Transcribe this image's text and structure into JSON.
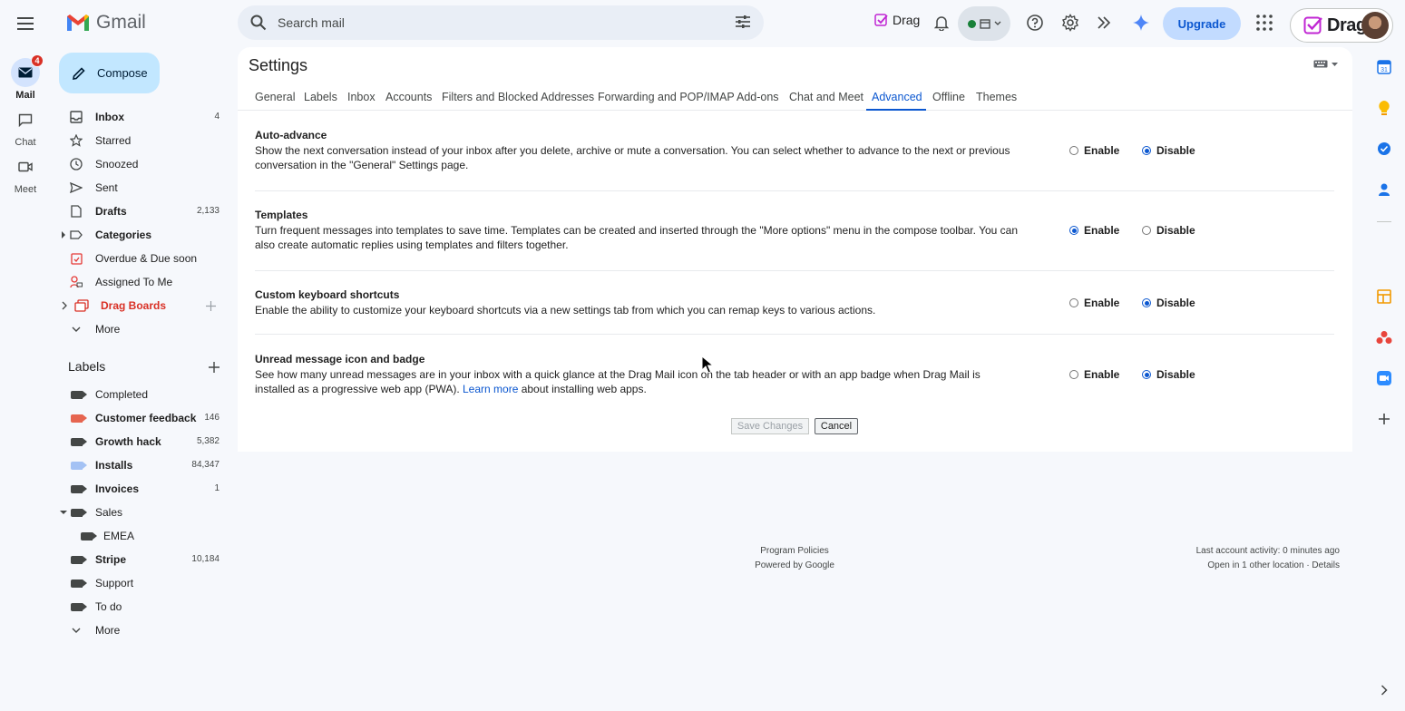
{
  "app": {
    "name": "Gmail"
  },
  "search": {
    "placeholder": "Search mail"
  },
  "topbar": {
    "drag_chip": "Drag",
    "upgrade": "Upgrade",
    "account_brand": "Drag"
  },
  "rail": [
    {
      "label": "Mail",
      "badge": "4"
    },
    {
      "label": "Chat"
    },
    {
      "label": "Meet"
    }
  ],
  "compose": {
    "label": "Compose"
  },
  "nav": {
    "inbox": {
      "label": "Inbox",
      "count": "4"
    },
    "starred": {
      "label": "Starred"
    },
    "snoozed": {
      "label": "Snoozed"
    },
    "sent": {
      "label": "Sent"
    },
    "drafts": {
      "label": "Drafts",
      "count": "2,133"
    },
    "categories": {
      "label": "Categories"
    },
    "overdue": {
      "label": "Overdue & Due soon"
    },
    "assigned": {
      "label": "Assigned To Me"
    },
    "drag_boards": {
      "label": "Drag Boards"
    },
    "more": {
      "label": "More"
    }
  },
  "labels": {
    "title": "Labels",
    "items": [
      {
        "label": "Completed",
        "count": "",
        "color": "#444746"
      },
      {
        "label": "Customer feedback",
        "count": "146",
        "color": "#e66550"
      },
      {
        "label": "Growth hack",
        "count": "5,382",
        "color": "#444746"
      },
      {
        "label": "Installs",
        "count": "84,347",
        "color": "#a4c2f4"
      },
      {
        "label": "Invoices",
        "count": "1",
        "color": "#444746"
      },
      {
        "label": "Sales",
        "count": "",
        "color": "#444746"
      },
      {
        "label": "EMEA",
        "count": "",
        "color": "#444746"
      },
      {
        "label": "Stripe",
        "count": "10,184",
        "color": "#444746"
      },
      {
        "label": "Support",
        "count": "",
        "color": "#444746"
      },
      {
        "label": "To do",
        "count": "",
        "color": "#444746"
      }
    ],
    "more": "More"
  },
  "settings": {
    "title": "Settings",
    "tabs": [
      "General",
      "Labels",
      "Inbox",
      "Accounts",
      "Filters and Blocked Addresses",
      "Forwarding and POP/IMAP",
      "Add-ons",
      "Chat and Meet",
      "Advanced",
      "Offline",
      "Themes"
    ],
    "active_tab": "Advanced",
    "rows": [
      {
        "title": "Auto-advance",
        "desc": "Show the next conversation instead of your inbox after you delete, archive or mute a conversation. You can select whether to advance to the next or previous conversation in the \"General\" Settings page.",
        "enable": "Enable",
        "disable": "Disable",
        "selected": "Disable"
      },
      {
        "title": "Templates",
        "desc": "Turn frequent messages into templates to save time. Templates can be created and inserted through the \"More options\" menu in the compose toolbar. You can also create automatic replies using templates and filters together.",
        "enable": "Enable",
        "disable": "Disable",
        "selected": "Enable"
      },
      {
        "title": "Custom keyboard shortcuts",
        "desc": "Enable the ability to customize your keyboard shortcuts via a new settings tab from which you can remap keys to various actions.",
        "enable": "Enable",
        "disable": "Disable",
        "selected": "Disable"
      },
      {
        "title": "Unread message icon and badge",
        "desc_before": "See how many unread messages are in your inbox with a quick glance at the Drag Mail icon on the tab header or with an app badge when Drag Mail is installed as a progressive web app (PWA). ",
        "desc_link": "Learn more",
        "desc_after": " about installing web apps.",
        "enable": "Enable",
        "disable": "Disable",
        "selected": "Disable"
      }
    ],
    "save": "Save Changes",
    "cancel": "Cancel"
  },
  "footer": {
    "program_policies": "Program Policies",
    "powered_by": "Powered by Google",
    "last_activity": "Last account activity: 0 minutes ago",
    "other_location": "Open in 1 other location · Details"
  }
}
